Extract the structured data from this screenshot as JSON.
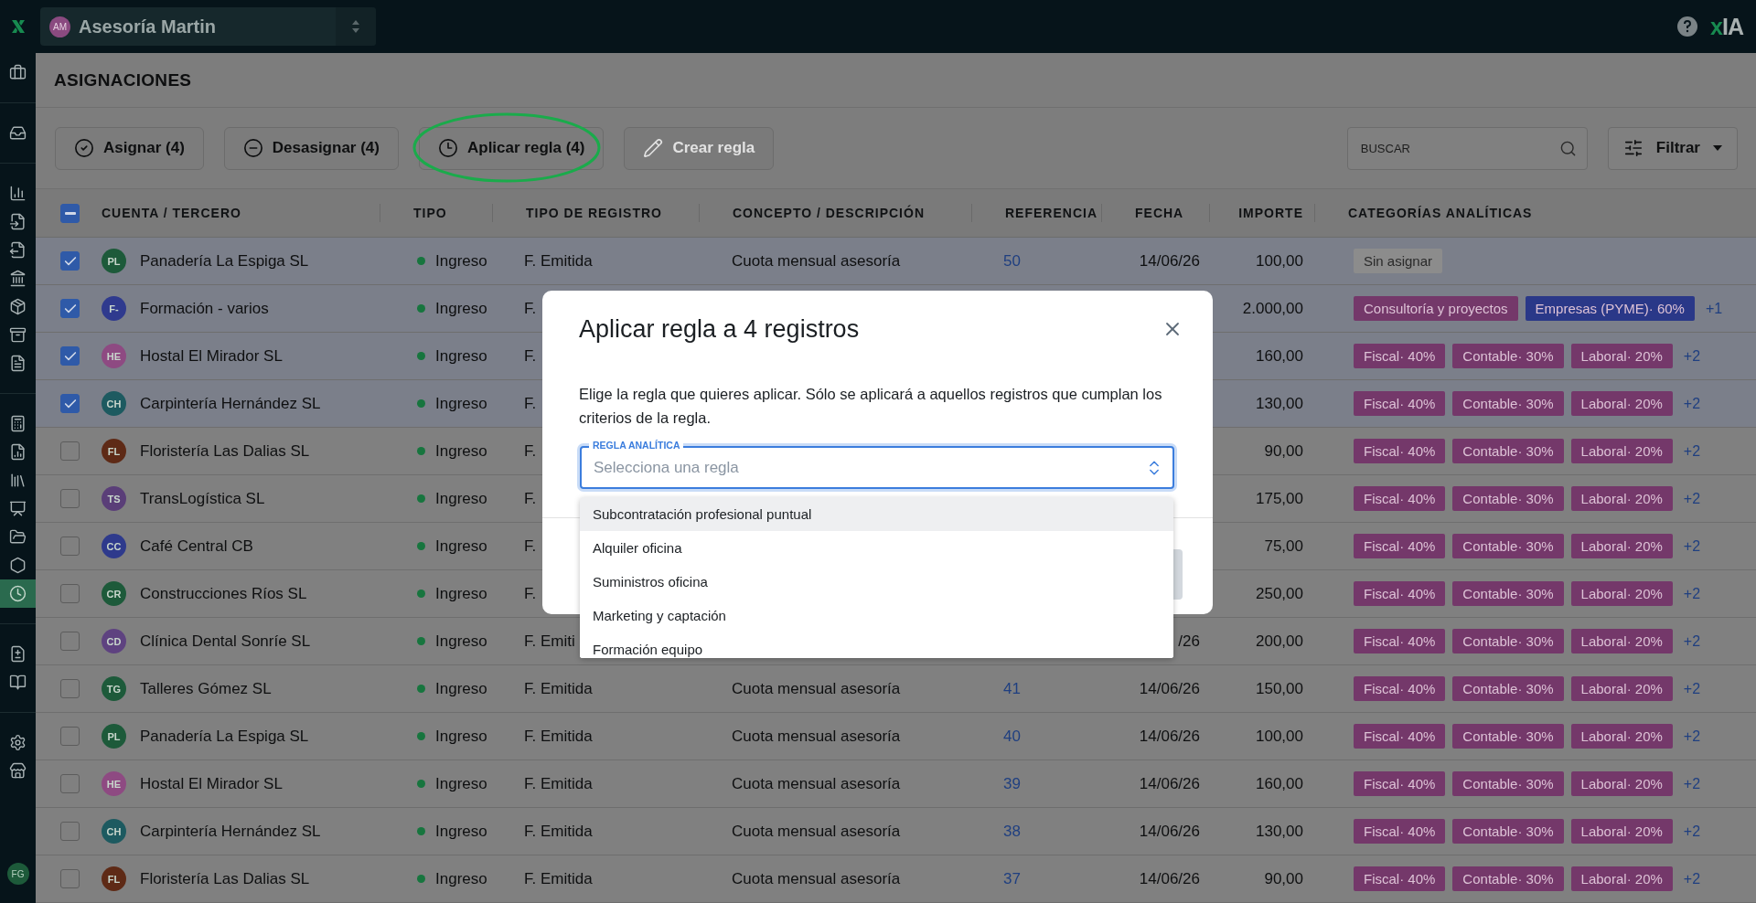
{
  "topbar": {
    "organization": {
      "initials": "AM",
      "name": "Asesoría Martin"
    },
    "ai_logo": "xIA"
  },
  "sidebar": {
    "groups": [
      {
        "items": [
          {
            "selected": false
          }
        ]
      },
      {
        "items": [
          {
            "selected": false
          }
        ]
      },
      {
        "items": [
          {
            "selected": false
          },
          {
            "selected": false
          },
          {
            "selected": false
          },
          {
            "selected": false
          },
          {
            "selected": false
          },
          {
            "selected": false
          },
          {
            "selected": false
          }
        ]
      },
      {
        "items": [
          {
            "selected": false
          },
          {
            "selected": false
          },
          {
            "selected": false
          },
          {
            "selected": false
          },
          {
            "selected": false
          },
          {
            "selected": false
          },
          {
            "selected": true
          }
        ]
      },
      {
        "items": [
          {
            "selected": false
          },
          {
            "selected": false
          }
        ]
      },
      {
        "items": [
          {
            "selected": false
          },
          {
            "selected": false
          }
        ]
      }
    ],
    "user": {
      "initials": "FG"
    }
  },
  "page": {
    "title": "ASIGNACIONES"
  },
  "toolbar": {
    "buttons": [
      {
        "label": "Asignar (4)",
        "disabled": false,
        "highlighted": false
      },
      {
        "label": "Desasignar (4)",
        "disabled": false,
        "highlighted": false
      },
      {
        "label": "Aplicar regla (4)",
        "disabled": false,
        "highlighted": true
      },
      {
        "label": "Crear regla",
        "disabled": true,
        "highlighted": false
      }
    ],
    "search": {
      "placeholder": "BUSCAR"
    },
    "filter": {
      "label": "Filtrar"
    }
  },
  "table": {
    "select_all": {
      "indeterminate": true
    },
    "columns": [
      "CUENTA / TERCERO",
      "TIPO",
      "TIPO DE REGISTRO",
      "CONCEPTO / DESCRIPCIÓN",
      "REFERENCIA",
      "FECHA",
      "IMPORTE",
      "CATEGORÍAS ANALÍTICAS"
    ],
    "rows": [
      {
        "checked": true,
        "avatar": {
          "initials": "PL",
          "color": "#1d5a3a"
        },
        "name": "Panadería La Espiga SL",
        "type": "Ingreso",
        "record_type": "F. Emitida",
        "concept": "Cuota mensual asesoría",
        "reference": "50",
        "date": "14/06/26",
        "amount": "100,00",
        "categories": [
          {
            "kind": "unassigned",
            "label": "Sin asignar",
            "color": "#8c8c8c"
          }
        ]
      },
      {
        "checked": true,
        "avatar": {
          "initials": "F-",
          "color": "#2f3a8e"
        },
        "name": "Formación - varios",
        "type": "Ingreso",
        "record_type": "F.",
        "amount": "2.000,00",
        "categories": [
          {
            "kind": "category",
            "label": "Consultoría y proyectos",
            "color": "#74386a"
          },
          {
            "kind": "category",
            "label": "Empresas (PYME)· 60%",
            "color": "#2a3888"
          }
        ],
        "more": "+1"
      },
      {
        "checked": true,
        "avatar": {
          "initials": "HE",
          "color": "#8e4a82"
        },
        "name": "Hostal El Mirador SL",
        "type": "Ingreso",
        "record_type": "F.",
        "amount": "160,00",
        "categories": [
          {
            "kind": "category",
            "label": "Fiscal· 40%",
            "color": "#74386a"
          },
          {
            "kind": "category",
            "label": "Contable· 30%",
            "color": "#74386a"
          },
          {
            "kind": "category",
            "label": "Laboral· 20%",
            "color": "#74386a"
          }
        ],
        "more": "+2"
      },
      {
        "checked": true,
        "avatar": {
          "initials": "CH",
          "color": "#1d5a60"
        },
        "name": "Carpintería Hernández SL",
        "type": "Ingreso",
        "record_type": "F.",
        "amount": "130,00",
        "categories": [
          {
            "kind": "category",
            "label": "Fiscal· 40%",
            "color": "#74386a"
          },
          {
            "kind": "category",
            "label": "Contable· 30%",
            "color": "#74386a"
          },
          {
            "kind": "category",
            "label": "Laboral· 20%",
            "color": "#74386a"
          }
        ],
        "more": "+2"
      },
      {
        "checked": false,
        "avatar": {
          "initials": "FL",
          "color": "#5e2a16"
        },
        "name": "Floristería Las Dalias SL",
        "type": "Ingreso",
        "record_type": "F.",
        "amount": "90,00",
        "categories": [
          {
            "kind": "category",
            "label": "Fiscal· 40%",
            "color": "#74386a"
          },
          {
            "kind": "category",
            "label": "Contable· 30%",
            "color": "#74386a"
          },
          {
            "kind": "category",
            "label": "Laboral· 20%",
            "color": "#74386a"
          }
        ],
        "more": "+2"
      },
      {
        "checked": false,
        "avatar": {
          "initials": "TS",
          "color": "#5a3e78"
        },
        "name": "TransLogística SL",
        "type": "Ingreso",
        "record_type": "F.",
        "amount": "175,00",
        "categories": [
          {
            "kind": "category",
            "label": "Fiscal· 40%",
            "color": "#74386a"
          },
          {
            "kind": "category",
            "label": "Contable· 30%",
            "color": "#74386a"
          },
          {
            "kind": "category",
            "label": "Laboral· 20%",
            "color": "#74386a"
          }
        ],
        "more": "+2"
      },
      {
        "checked": false,
        "avatar": {
          "initials": "CC",
          "color": "#2e3a8c"
        },
        "name": "Café Central CB",
        "type": "Ingreso",
        "record_type": "F.",
        "amount": "75,00",
        "categories": [
          {
            "kind": "category",
            "label": "Fiscal· 40%",
            "color": "#74386a"
          },
          {
            "kind": "category",
            "label": "Contable· 30%",
            "color": "#74386a"
          },
          {
            "kind": "category",
            "label": "Laboral· 20%",
            "color": "#74386a"
          }
        ],
        "more": "+2"
      },
      {
        "checked": false,
        "avatar": {
          "initials": "CR",
          "color": "#1d5a3a"
        },
        "name": "Construcciones Ríos SL",
        "type": "Ingreso",
        "record_type": "F.",
        "amount": "250,00",
        "categories": [
          {
            "kind": "category",
            "label": "Fiscal· 40%",
            "color": "#74386a"
          },
          {
            "kind": "category",
            "label": "Contable· 30%",
            "color": "#74386a"
          },
          {
            "kind": "category",
            "label": "Laboral· 20%",
            "color": "#74386a"
          }
        ],
        "more": "+2"
      },
      {
        "checked": false,
        "avatar": {
          "initials": "CD",
          "color": "#5e4280"
        },
        "name": "Clínica Dental Sonríe SL",
        "type": "Ingreso",
        "record_type": "F. Emiti",
        "date": "/26",
        "amount": "200,00",
        "categories": [
          {
            "kind": "category",
            "label": "Fiscal· 40%",
            "color": "#74386a"
          },
          {
            "kind": "category",
            "label": "Contable· 30%",
            "color": "#74386a"
          },
          {
            "kind": "category",
            "label": "Laboral· 20%",
            "color": "#74386a"
          }
        ],
        "more": "+2"
      },
      {
        "checked": false,
        "avatar": {
          "initials": "TG",
          "color": "#1d5a3a"
        },
        "name": "Talleres Gómez SL",
        "type": "Ingreso",
        "record_type": "F. Emitida",
        "concept": "Cuota mensual asesoría",
        "reference": "41",
        "date": "14/06/26",
        "amount": "150,00",
        "categories": [
          {
            "kind": "category",
            "label": "Fiscal· 40%",
            "color": "#74386a"
          },
          {
            "kind": "category",
            "label": "Contable· 30%",
            "color": "#74386a"
          },
          {
            "kind": "category",
            "label": "Laboral· 20%",
            "color": "#74386a"
          }
        ],
        "more": "+2"
      },
      {
        "checked": false,
        "avatar": {
          "initials": "PL",
          "color": "#1d5a3a"
        },
        "name": "Panadería La Espiga SL",
        "type": "Ingreso",
        "record_type": "F. Emitida",
        "concept": "Cuota mensual asesoría",
        "reference": "40",
        "date": "14/06/26",
        "amount": "100,00",
        "categories": [
          {
            "kind": "category",
            "label": "Fiscal· 40%",
            "color": "#74386a"
          },
          {
            "kind": "category",
            "label": "Contable· 30%",
            "color": "#74386a"
          },
          {
            "kind": "category",
            "label": "Laboral· 20%",
            "color": "#74386a"
          }
        ],
        "more": "+2"
      },
      {
        "checked": false,
        "avatar": {
          "initials": "HE",
          "color": "#8e4a82"
        },
        "name": "Hostal El Mirador SL",
        "type": "Ingreso",
        "record_type": "F. Emitida",
        "concept": "Cuota mensual asesoría",
        "reference": "39",
        "date": "14/06/26",
        "amount": "160,00",
        "categories": [
          {
            "kind": "category",
            "label": "Fiscal· 40%",
            "color": "#74386a"
          },
          {
            "kind": "category",
            "label": "Contable· 30%",
            "color": "#74386a"
          },
          {
            "kind": "category",
            "label": "Laboral· 20%",
            "color": "#74386a"
          }
        ],
        "more": "+2"
      },
      {
        "checked": false,
        "avatar": {
          "initials": "CH",
          "color": "#1d5a60"
        },
        "name": "Carpintería Hernández SL",
        "type": "Ingreso",
        "record_type": "F. Emitida",
        "concept": "Cuota mensual asesoría",
        "reference": "38",
        "date": "14/06/26",
        "amount": "130,00",
        "categories": [
          {
            "kind": "category",
            "label": "Fiscal· 40%",
            "color": "#74386a"
          },
          {
            "kind": "category",
            "label": "Contable· 30%",
            "color": "#74386a"
          },
          {
            "kind": "category",
            "label": "Laboral· 20%",
            "color": "#74386a"
          }
        ],
        "more": "+2"
      },
      {
        "checked": false,
        "avatar": {
          "initials": "FL",
          "color": "#5e2a16"
        },
        "name": "Floristería Las Dalias SL",
        "type": "Ingreso",
        "record_type": "F. Emitida",
        "concept": "Cuota mensual asesoría",
        "reference": "37",
        "date": "14/06/26",
        "amount": "90,00",
        "categories": [
          {
            "kind": "category",
            "label": "Fiscal· 40%",
            "color": "#74386a"
          },
          {
            "kind": "category",
            "label": "Contable· 30%",
            "color": "#74386a"
          },
          {
            "kind": "category",
            "label": "Laboral· 20%",
            "color": "#74386a"
          }
        ],
        "more": "+2"
      }
    ]
  },
  "dialog": {
    "title": "Aplicar regla a 4 registros",
    "description": "Elige la regla que quieres aplicar. Sólo se aplicará a aquellos registros que cumplan los criterios de la regla.",
    "field": {
      "label": "REGLA ANALÍTICA",
      "placeholder": "Selecciona una regla"
    },
    "options": [
      {
        "label": "Subcontratación profesional puntual",
        "selected": true
      },
      {
        "label": "Alquiler oficina",
        "selected": false
      },
      {
        "label": "Suministros oficina",
        "selected": false
      },
      {
        "label": "Marketing y captación",
        "selected": false
      },
      {
        "label": "Formación equipo",
        "selected": false
      }
    ]
  }
}
